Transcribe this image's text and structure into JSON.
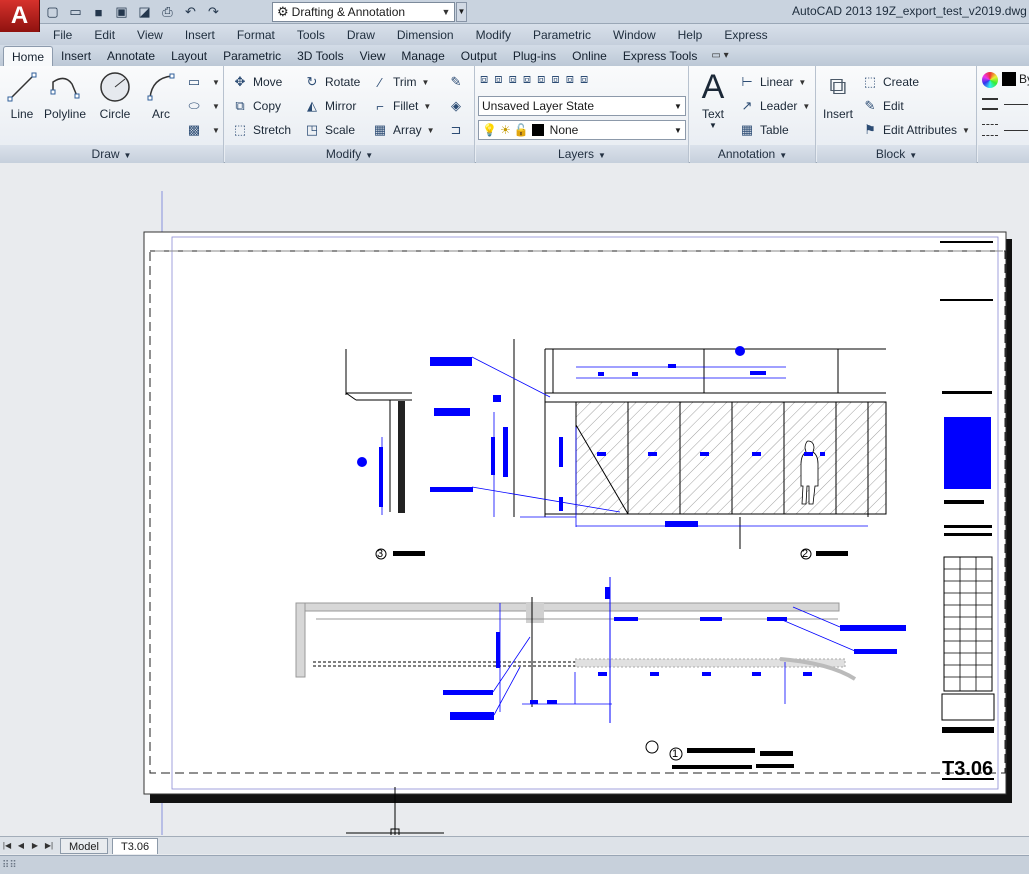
{
  "titlebar": {
    "app_logo": "A",
    "workspace": "Drafting & Annotation",
    "window_title": "AutoCAD 2013    19Z_export_test_v2019.dwg"
  },
  "menu": [
    "File",
    "Edit",
    "View",
    "Insert",
    "Format",
    "Tools",
    "Draw",
    "Dimension",
    "Modify",
    "Parametric",
    "Window",
    "Help",
    "Express"
  ],
  "ribbon_tabs": [
    "Home",
    "Insert",
    "Annotate",
    "Layout",
    "Parametric",
    "3D Tools",
    "View",
    "Manage",
    "Output",
    "Plug-ins",
    "Online",
    "Express Tools"
  ],
  "draw": {
    "title": "Draw",
    "line": "Line",
    "polyline": "Polyline",
    "circle": "Circle",
    "arc": "Arc"
  },
  "modify": {
    "title": "Modify",
    "move": "Move",
    "rotate": "Rotate",
    "trim": "Trim",
    "copy": "Copy",
    "mirror": "Mirror",
    "fillet": "Fillet",
    "stretch": "Stretch",
    "scale": "Scale",
    "array": "Array"
  },
  "layers": {
    "title": "Layers",
    "state": "Unsaved Layer State",
    "current": "None"
  },
  "annotation": {
    "title": "Annotation",
    "text": "Text",
    "linear": "Linear",
    "leader": "Leader",
    "table": "Table"
  },
  "block": {
    "title": "Block",
    "insert": "Insert",
    "create": "Create",
    "edit": "Edit",
    "edit_attributes": "Edit Attributes"
  },
  "properties": {
    "bylayer": "By"
  },
  "drawing": {
    "sheet_number": "T3.06",
    "callout_1": "1",
    "callout_2": "2",
    "callout_3": "3"
  },
  "layout_tabs": [
    "Model",
    "T3.06"
  ]
}
